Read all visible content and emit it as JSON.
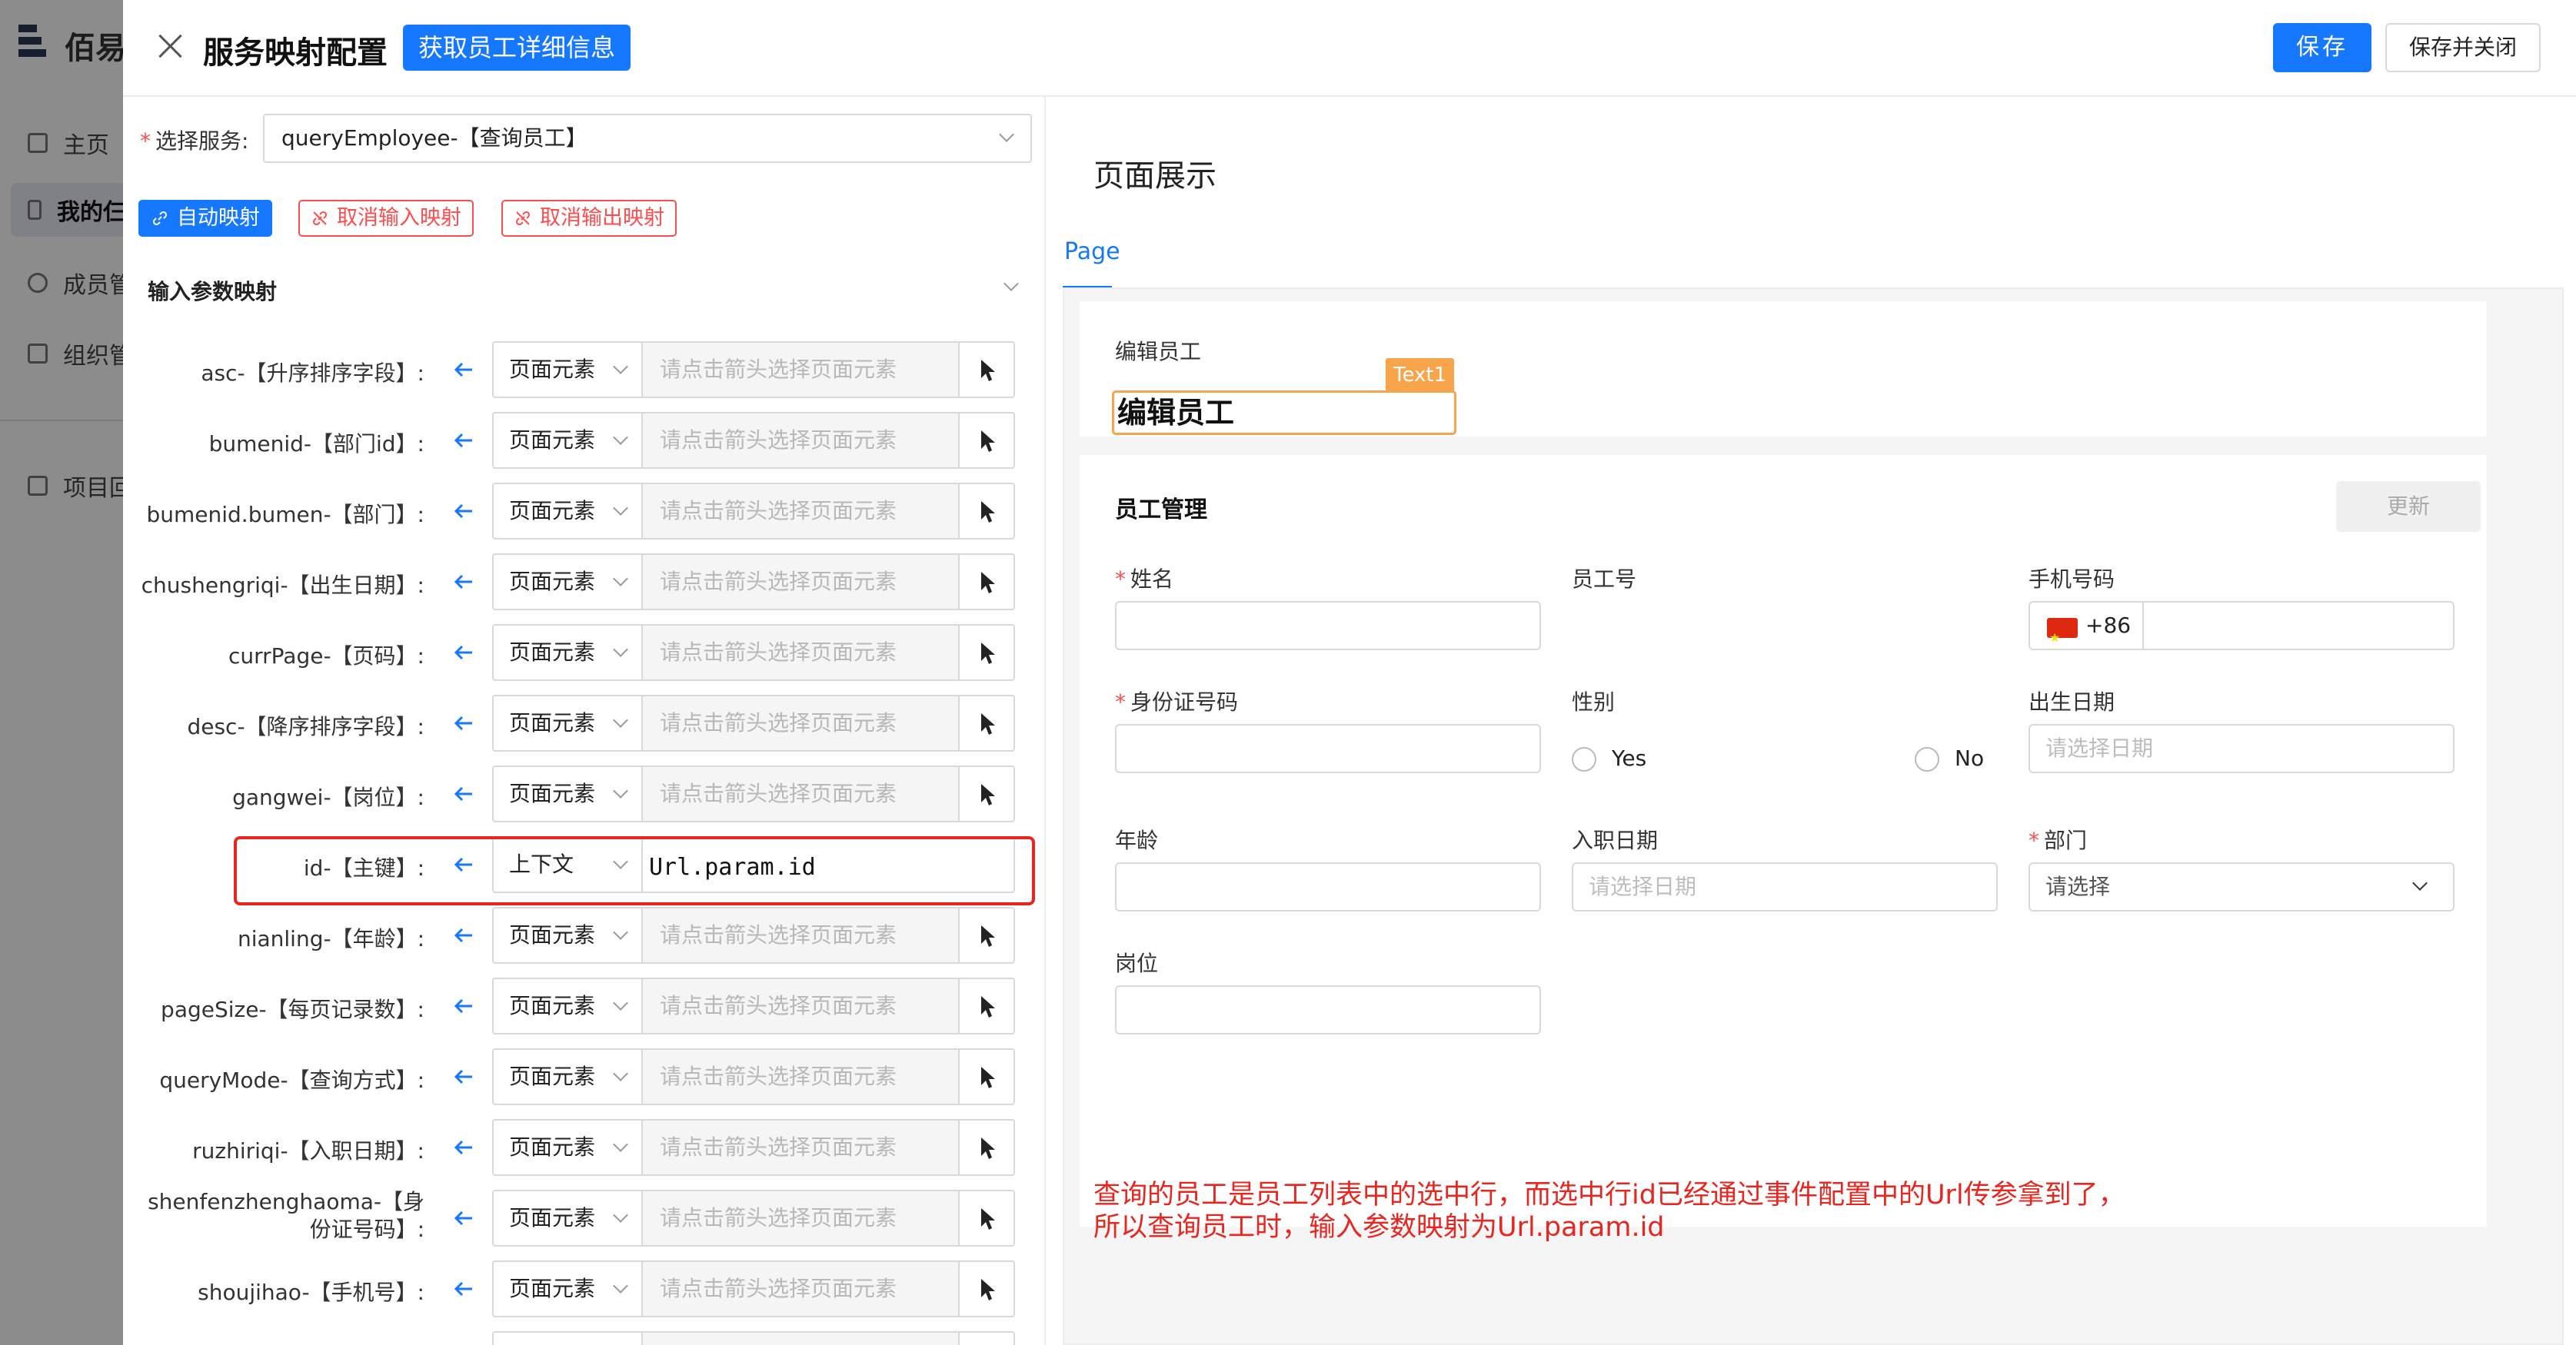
{
  "background": {
    "brand": "佰易",
    "nav": [
      "主页",
      "我的仨",
      "成员管",
      "组织管",
      "项目回"
    ]
  },
  "header": {
    "title": "服务映射配置",
    "fetch_button": "获取员工详细信息",
    "save_button": "保存",
    "save_close_button": "保存并关闭"
  },
  "left": {
    "service_label": "选择服务:",
    "service_value": "queryEmployee-【查询员工】",
    "auto_map": "自动映射",
    "cancel_input": "取消输入映射",
    "cancel_output": "取消输出映射",
    "section_title": "输入参数映射",
    "value_placeholder": "请点击箭头选择页面元素",
    "params": [
      {
        "label": "asc-【升序排序字段】:",
        "type": "页面元素",
        "value": ""
      },
      {
        "label": "bumenid-【部门id】:",
        "type": "页面元素",
        "value": ""
      },
      {
        "label": "bumenid.bumen-【部门】:",
        "type": "页面元素",
        "value": ""
      },
      {
        "label": "chushengriqi-【出生日期】:",
        "type": "页面元素",
        "value": ""
      },
      {
        "label": "currPage-【页码】:",
        "type": "页面元素",
        "value": ""
      },
      {
        "label": "desc-【降序排序字段】:",
        "type": "页面元素",
        "value": ""
      },
      {
        "label": "gangwei-【岗位】:",
        "type": "页面元素",
        "value": ""
      },
      {
        "label": "id-【主键】:",
        "type": "上下文",
        "value": "Url.param.id"
      },
      {
        "label": "nianling-【年龄】:",
        "type": "页面元素",
        "value": ""
      },
      {
        "label": "pageSize-【每页记录数】:",
        "type": "页面元素",
        "value": ""
      },
      {
        "label": "queryMode-【查询方式】:",
        "type": "页面元素",
        "value": ""
      },
      {
        "label": "ruzhiriqi-【入职日期】:",
        "type": "页面元素",
        "value": ""
      },
      {
        "label": "shenfenzhenghaoma-【身份证号码】:",
        "type": "页面元素",
        "value": ""
      },
      {
        "label": "shoujihao-【手机号】:",
        "type": "页面元素",
        "value": ""
      },
      {
        "label": "",
        "type": "",
        "value": ""
      }
    ]
  },
  "right": {
    "preview_title": "页面展示",
    "tab": "Page",
    "card1_label": "编辑员工",
    "text1_badge": "Text1",
    "text1_value": "编辑员工",
    "form_title": "员工管理",
    "refresh": "更新",
    "fields": {
      "name": "姓名",
      "emp_no": "员工号",
      "phone": "手机号码",
      "phone_prefix": "+86",
      "id_no": "身份证号码",
      "gender": "性别",
      "yes": "Yes",
      "no": "No",
      "birth": "出生日期",
      "birth_ph": "请选择日期",
      "age": "年龄",
      "hire": "入职日期",
      "hire_ph": "请选择日期",
      "dept": "部门",
      "dept_ph": "请选择",
      "post": "岗位"
    },
    "annotation_line1": "查询的员工是员工列表中的选中行，而选中行id已经通过事件配置中的Url传参拿到了，",
    "annotation_line2": "所以查询员工时，输入参数映射为Url.param.id"
  },
  "colors": {
    "primary": "#1677ff",
    "danger": "#ff4d4f",
    "highlight": "#e8251f",
    "badge": "#f7a44a"
  }
}
